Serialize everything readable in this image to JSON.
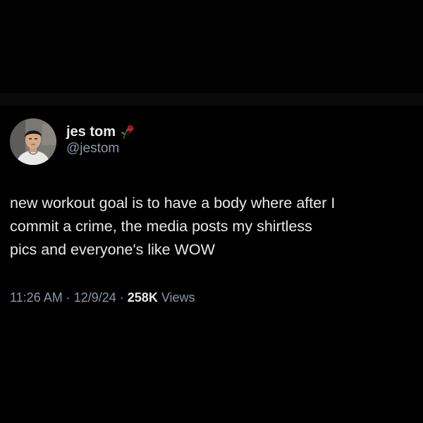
{
  "tweet": {
    "author": {
      "display_name": "jes tom",
      "handle": "@jestom",
      "avatar_icon": "avatar-photo",
      "name_emoji_icon": "wilted-rose-icon"
    },
    "text": "new workout goal is to have a body where after I\ncommit a crime, the media posts my shirtless\npics and everyone's like WOW",
    "meta": {
      "time": "11:26 AM",
      "separator": "·",
      "date": "12/9/24",
      "views_count": "258K",
      "views_label": "Views"
    }
  },
  "colors": {
    "background": "#000000",
    "primary_text": "#e7e9ea",
    "secondary_text": "#8b98a5"
  }
}
